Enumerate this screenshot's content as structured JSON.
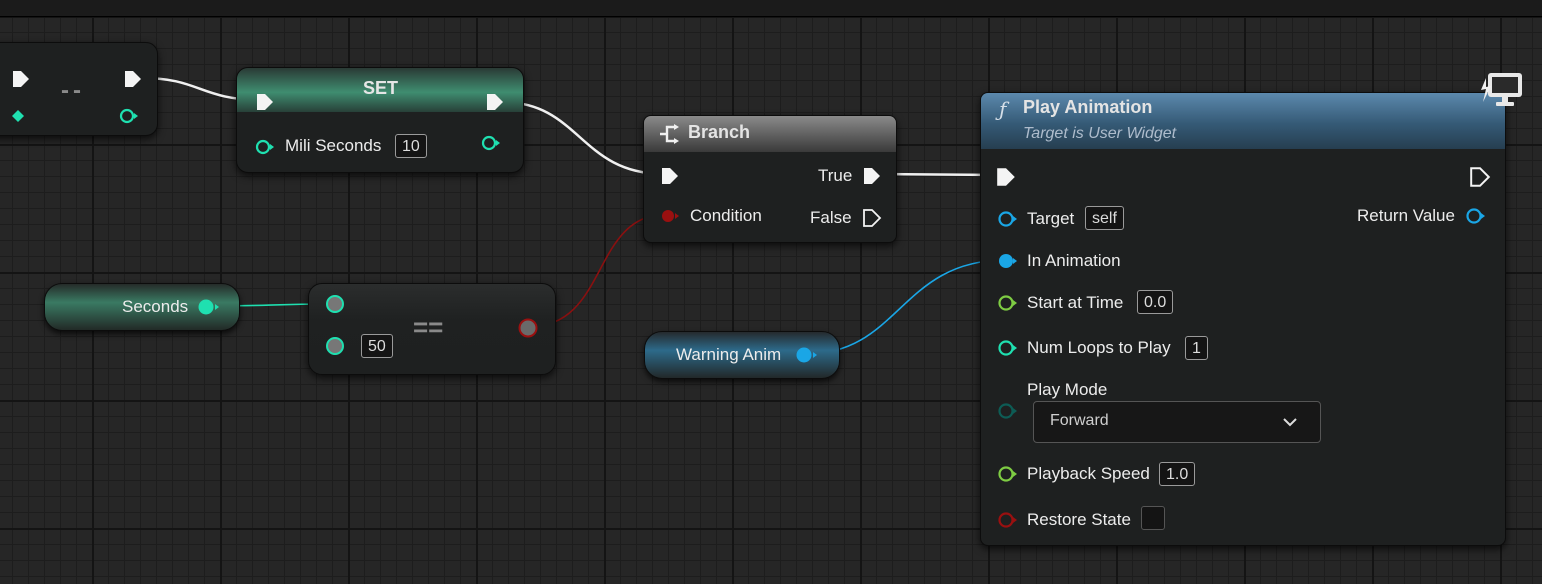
{
  "nodes": {
    "decrement": {
      "label": "--"
    },
    "set": {
      "title": "SET",
      "var_label": "Mili Seconds",
      "value": "10"
    },
    "branch": {
      "title": "Branch",
      "true_label": "True",
      "false_label": "False",
      "condition_label": "Condition"
    },
    "seconds_getter": {
      "label": "Seconds"
    },
    "equals": {
      "op": "==",
      "value": "50"
    },
    "warning_anim": {
      "label": "Warning Anim"
    },
    "play_animation": {
      "function_icon": "ƒ",
      "title": "Play Animation",
      "subtitle": "Target is User Widget",
      "target_label": "Target",
      "target_value": "self",
      "return_label": "Return Value",
      "in_animation_label": "In Animation",
      "start_time_label": "Start at Time",
      "start_time_value": "0.0",
      "num_loops_label": "Num Loops to Play",
      "num_loops_value": "1",
      "play_mode_label": "Play Mode",
      "play_mode_value": "Forward",
      "playback_speed_label": "Playback Speed",
      "playback_speed_value": "1.0",
      "restore_state_label": "Restore State"
    }
  },
  "colors": {
    "exec": "#ffffff",
    "integer": "#1fe0b0",
    "float": "#7ecc43",
    "object": "#1aa6e6",
    "boolean": "#9a1010",
    "enum": "#0d5c55",
    "variable_header": "#2f8a6c",
    "function_header": "#3e6a8a"
  },
  "icons": {
    "branch": "branch-icon",
    "function": "function-icon",
    "widget": "widget-monitor-icon",
    "dropdown": "chevron-down-icon"
  }
}
